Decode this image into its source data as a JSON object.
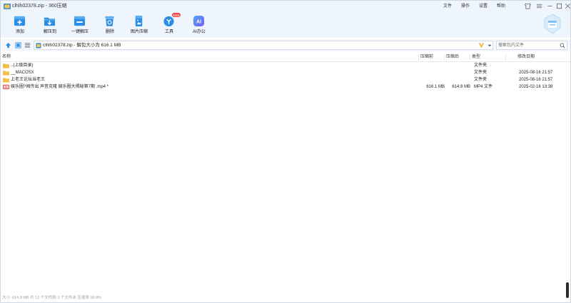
{
  "window": {
    "title": "clhlh02378.zip - 360压缩",
    "menu": [
      "文件",
      "操作",
      "设置",
      "帮助"
    ]
  },
  "toolbar": {
    "tools": [
      {
        "label": "添加",
        "icon": "add-icon",
        "color": "#2a8ee6"
      },
      {
        "label": "解压到",
        "icon": "extract-to-icon",
        "color": "#2a8ee6"
      },
      {
        "label": "一键解压",
        "icon": "one-click-extract-icon",
        "color": "#2a8ee6"
      },
      {
        "label": "删除",
        "icon": "trash-icon",
        "color": "#2a8ee6"
      },
      {
        "label": "图片压缩",
        "icon": "image-compress-icon",
        "color": "#2a8ee6"
      },
      {
        "label": "工具",
        "icon": "tools-icon",
        "color": "#2a8ee6",
        "badge": "New"
      },
      {
        "label": "AI办公",
        "icon": "ai-office-icon",
        "color": "#6a5cf0"
      }
    ]
  },
  "addressbar": {
    "path": "clhlh02378.zip - 解包大小为 616.1 MB",
    "search_placeholder": "搜索包内文件"
  },
  "columns": [
    "名称",
    "压缩前",
    "压缩后",
    "类型",
    "修改日期"
  ],
  "files": [
    {
      "name": "..(上级目录)",
      "before": "",
      "after": "",
      "type": "文件夹",
      "date": "",
      "icon": "folder-icon"
    },
    {
      "name": "__MACOSX",
      "before": "",
      "after": "",
      "type": "文件夹",
      "date": "2025-08-16 21:57",
      "icon": "folder-icon"
    },
    {
      "name": "上老王论坛当老王",
      "before": "",
      "after": "",
      "type": "文件夹",
      "date": "2025-08-16 21:57",
      "icon": "folder-icon"
    },
    {
      "name": "娱乐圈?闻传出 声音克隆  娱乐圈大揭秘第7期 .mp4 *",
      "before": "616.1 MB",
      "after": "614.9 MB",
      "type": "MP4 文件",
      "date": "2025-02-16 13:38",
      "icon": "video-file-icon"
    }
  ],
  "status": "大小: 614.9 MB 共 12 个文件和 3 个文件夹 压缩率 99.8%",
  "colors": {
    "accent": "#2a8ee6",
    "folder": "#f5c04a",
    "toolbar_bg": "#eef5fd"
  }
}
